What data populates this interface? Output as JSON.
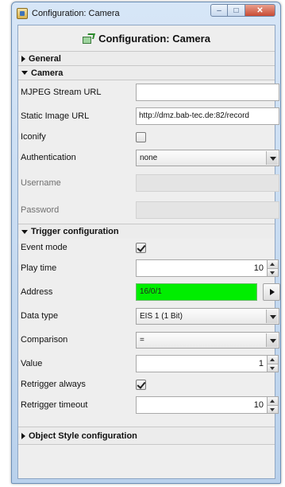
{
  "window": {
    "title": "Configuration: Camera",
    "controls": [
      "minimize-icon",
      "maximize-icon",
      "close-icon"
    ]
  },
  "header": {
    "title": "Configuration: Camera",
    "icon": "edit-icon"
  },
  "sections": {
    "general": {
      "label": "General",
      "expanded": false
    },
    "camera": {
      "label": "Camera",
      "expanded": true,
      "mjpeg_label": "MJPEG Stream URL",
      "mjpeg_value": "",
      "static_label": "Static Image URL",
      "static_value": "http://dmz.bab-tec.de:82/record",
      "iconify_label": "Iconify",
      "iconify_checked": false,
      "auth_label": "Authentication",
      "auth_value": "none",
      "username_label": "Username",
      "password_label": "Password"
    },
    "trigger": {
      "label": "Trigger configuration",
      "expanded": true,
      "event_mode_label": "Event mode",
      "event_mode_checked": true,
      "play_time_label": "Play time",
      "play_time_value": "10",
      "address_label": "Address",
      "address_value": "16/0/1",
      "address_color": "#00ee00",
      "data_type_label": "Data type",
      "data_type_value": "EIS 1 (1 Bit)",
      "comparison_label": "Comparison",
      "comparison_value": "=",
      "value_label": "Value",
      "value_value": "1",
      "retrigger_always_label": "Retrigger always",
      "retrigger_always_checked": true,
      "retrigger_timeout_label": "Retrigger timeout",
      "retrigger_timeout_value": "10"
    },
    "object_style": {
      "label": "Object Style configuration",
      "expanded": false
    }
  }
}
